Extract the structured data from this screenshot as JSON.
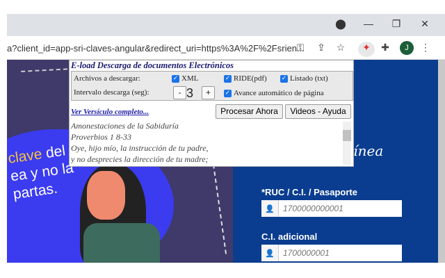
{
  "browser": {
    "url": "a?client_id=app-sri-claves-angular&redirect_uri=https%3A%2F%2Fsrien...",
    "avatar_letter": "J"
  },
  "page": {
    "slogan": [
      "clave del",
      "ea y no la",
      "partas."
    ],
    "slogan_highlight": "clave",
    "script_text": "Línea",
    "ruc_label": "*RUC / C.I. / Pasaporte",
    "ruc_placeholder": "1700000000001",
    "ci_label": "C.I. adicional",
    "ci_placeholder": "1700000001"
  },
  "popup": {
    "title": "E-load Descarga de documentos Electrónicos",
    "files_label": "Archivos a descargar:",
    "xml": "XML",
    "ride": "RIDE(pdf)",
    "listado": "Listado (txt)",
    "interval_label": "Intervalo descarga (seg):",
    "minus": "-",
    "interval": "3",
    "plus": "+",
    "auto": "Avance automático de página",
    "link": "Ver Versículo completo...",
    "process": "Procesar Ahora",
    "videos": "Videos - Ayuda",
    "verse": [
      "Amonestaciones de la Sabiduría",
      "Proverbios 1 8-33",
      "Oye, hijo mío, la instrucción de tu padre,",
      "y no desprecies la dirección de tu madre;"
    ]
  }
}
